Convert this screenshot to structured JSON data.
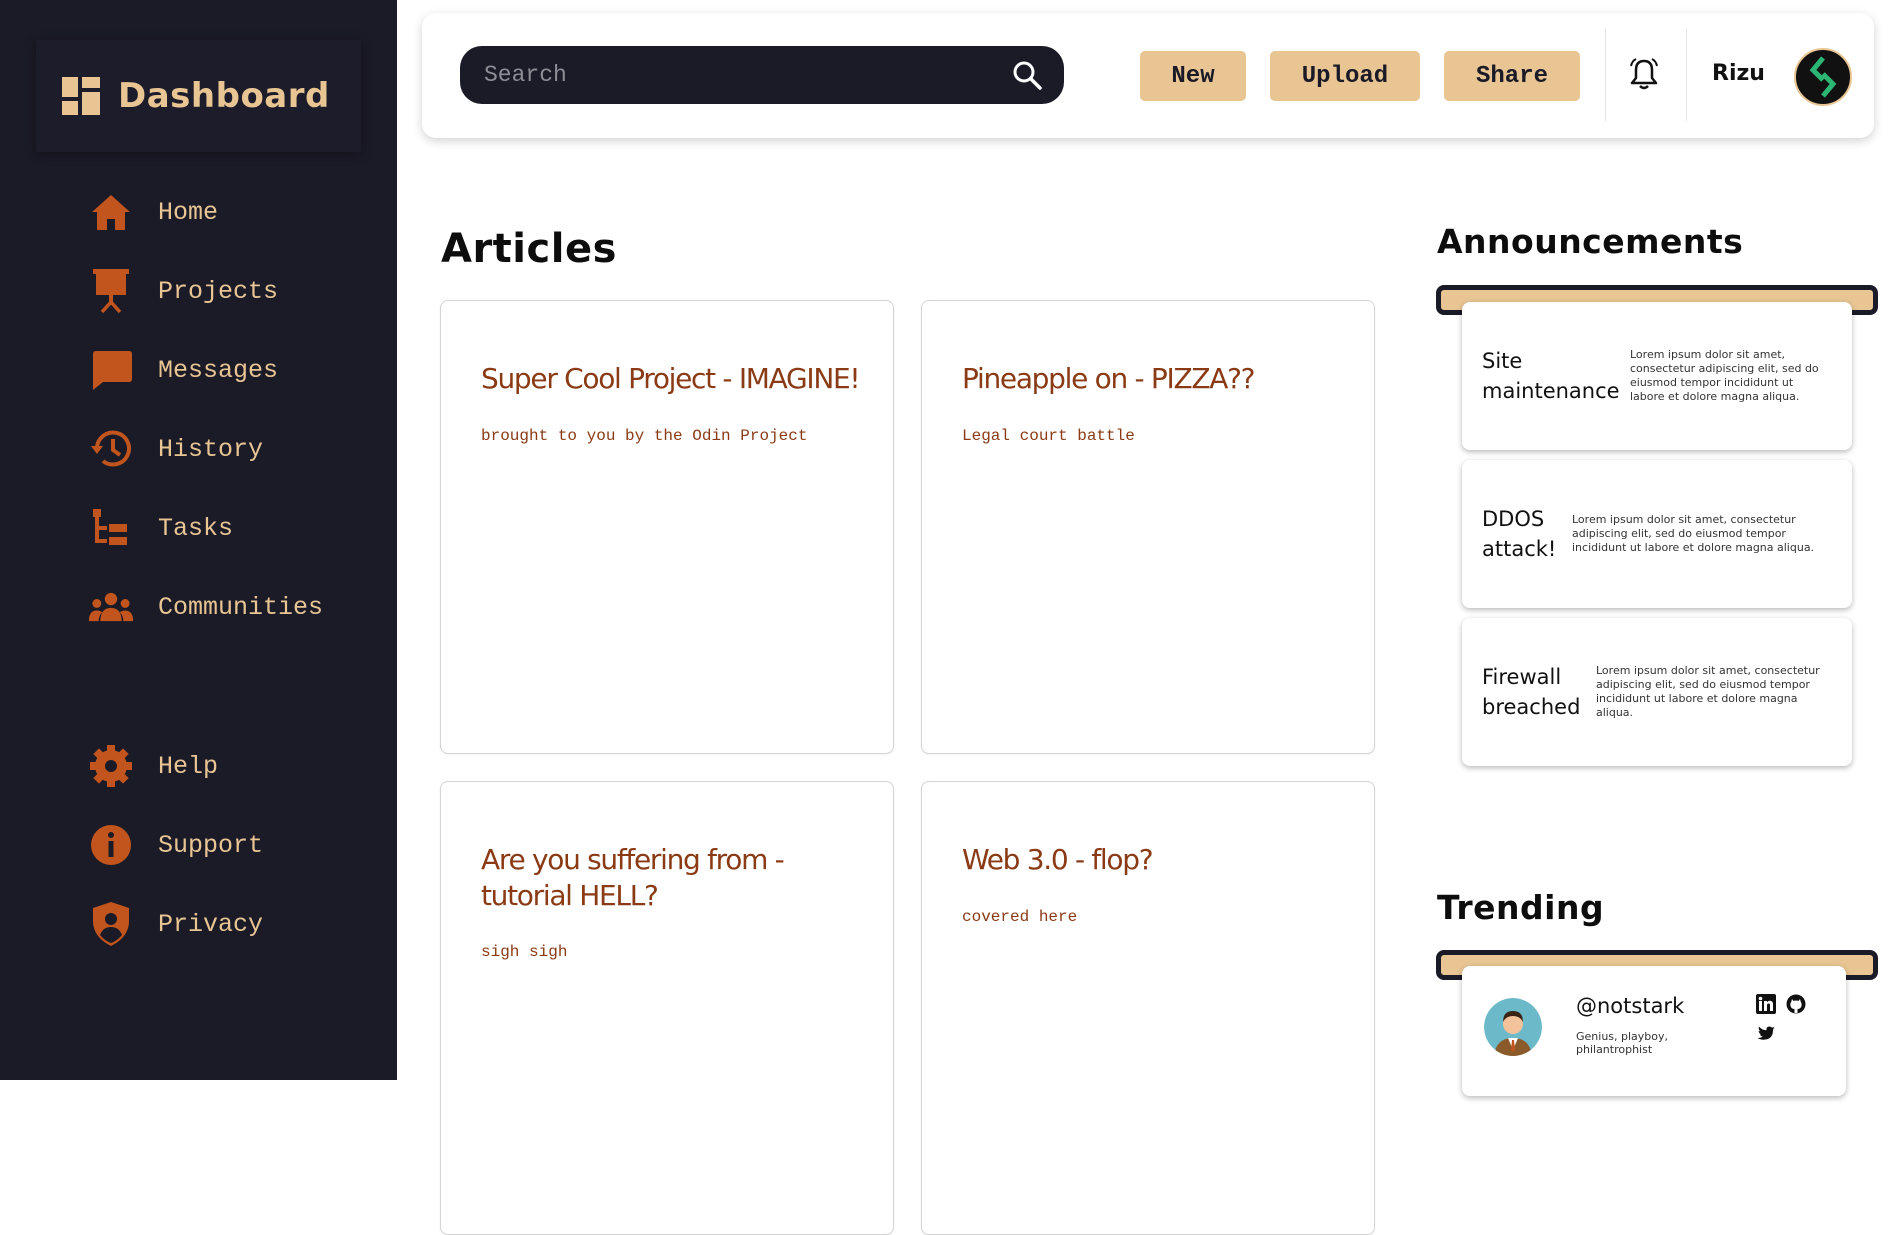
{
  "brand": {
    "title": "Dashboard"
  },
  "colors": {
    "sidebar": "#1b1a27",
    "accent": "#e8c593",
    "icon": "#c2551d",
    "article_text": "#8a3a14"
  },
  "nav": {
    "top": [
      {
        "label": "Home",
        "icon": "home-icon"
      },
      {
        "label": "Projects",
        "icon": "presentation-icon"
      },
      {
        "label": "Messages",
        "icon": "message-icon"
      },
      {
        "label": "History",
        "icon": "history-icon"
      },
      {
        "label": "Tasks",
        "icon": "tasks-icon"
      },
      {
        "label": "Communities",
        "icon": "communities-icon"
      }
    ],
    "bottom": [
      {
        "label": "Help",
        "icon": "gear-icon"
      },
      {
        "label": "Support",
        "icon": "info-icon"
      },
      {
        "label": "Privacy",
        "icon": "shield-icon"
      }
    ]
  },
  "header": {
    "search_placeholder": "Search",
    "buttons": {
      "new": "New",
      "upload": "Upload",
      "share": "Share"
    },
    "username": "Rizu"
  },
  "articles": {
    "title": "Articles",
    "items": [
      {
        "title": "Super Cool Project - IMAGINE!",
        "subtitle": "brought to you by the Odin Project"
      },
      {
        "title": "Pineapple on - PIZZA??",
        "subtitle": "Legal court battle"
      },
      {
        "title": "Are you suffering from - tutorial HELL?",
        "subtitle": "sigh sigh"
      },
      {
        "title": "Web 3.0 - flop?",
        "subtitle": "covered here"
      }
    ]
  },
  "announcements": {
    "title": "Announcements",
    "items": [
      {
        "title_line1": "Site",
        "title_line2": "maintenance",
        "text": "Lorem ipsum dolor sit amet, consectetur adipiscing elit, sed do eiusmod tempor incididunt ut labore et dolore magna aliqua."
      },
      {
        "title_line1": "DDOS",
        "title_line2": "attack!",
        "text": "Lorem ipsum dolor sit amet, consectetur adipiscing elit, sed do eiusmod tempor incididunt ut labore et dolore magna aliqua."
      },
      {
        "title_line1": "Firewall",
        "title_line2": "breached",
        "text": "Lorem ipsum dolor sit amet, consectetur adipiscing elit, sed do eiusmod tempor incididunt ut labore et dolore magna aliqua."
      }
    ]
  },
  "trending": {
    "title": "Trending",
    "user": {
      "handle": "@notstark",
      "bio": "Genius, playboy, philantrophist"
    }
  }
}
